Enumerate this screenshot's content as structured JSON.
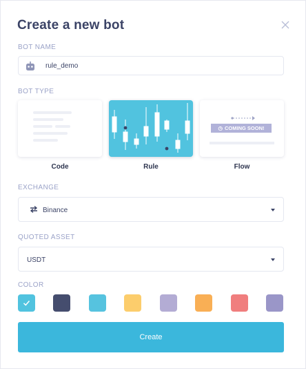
{
  "dialog": {
    "title": "Create a new bot"
  },
  "bot_name": {
    "label": "BOT NAME",
    "value": "rule_demo"
  },
  "bot_type": {
    "label": "BOT TYPE",
    "selected": "Rule",
    "options": [
      {
        "name": "Code"
      },
      {
        "name": "Rule"
      },
      {
        "name": "Flow",
        "badge": "COMING SOON!"
      }
    ]
  },
  "exchange": {
    "label": "EXCHANGE",
    "value": "Binance"
  },
  "quoted_asset": {
    "label": "QUOTED ASSET",
    "value": "USDT"
  },
  "color": {
    "label": "COLOR",
    "selected_index": 0,
    "swatches": [
      "#51c3df",
      "#454d6e",
      "#56c3df",
      "#fccd6c",
      "#b3acd4",
      "#f9af55",
      "#f07e7e",
      "#9a96c8"
    ]
  },
  "actions": {
    "create_label": "Create"
  }
}
